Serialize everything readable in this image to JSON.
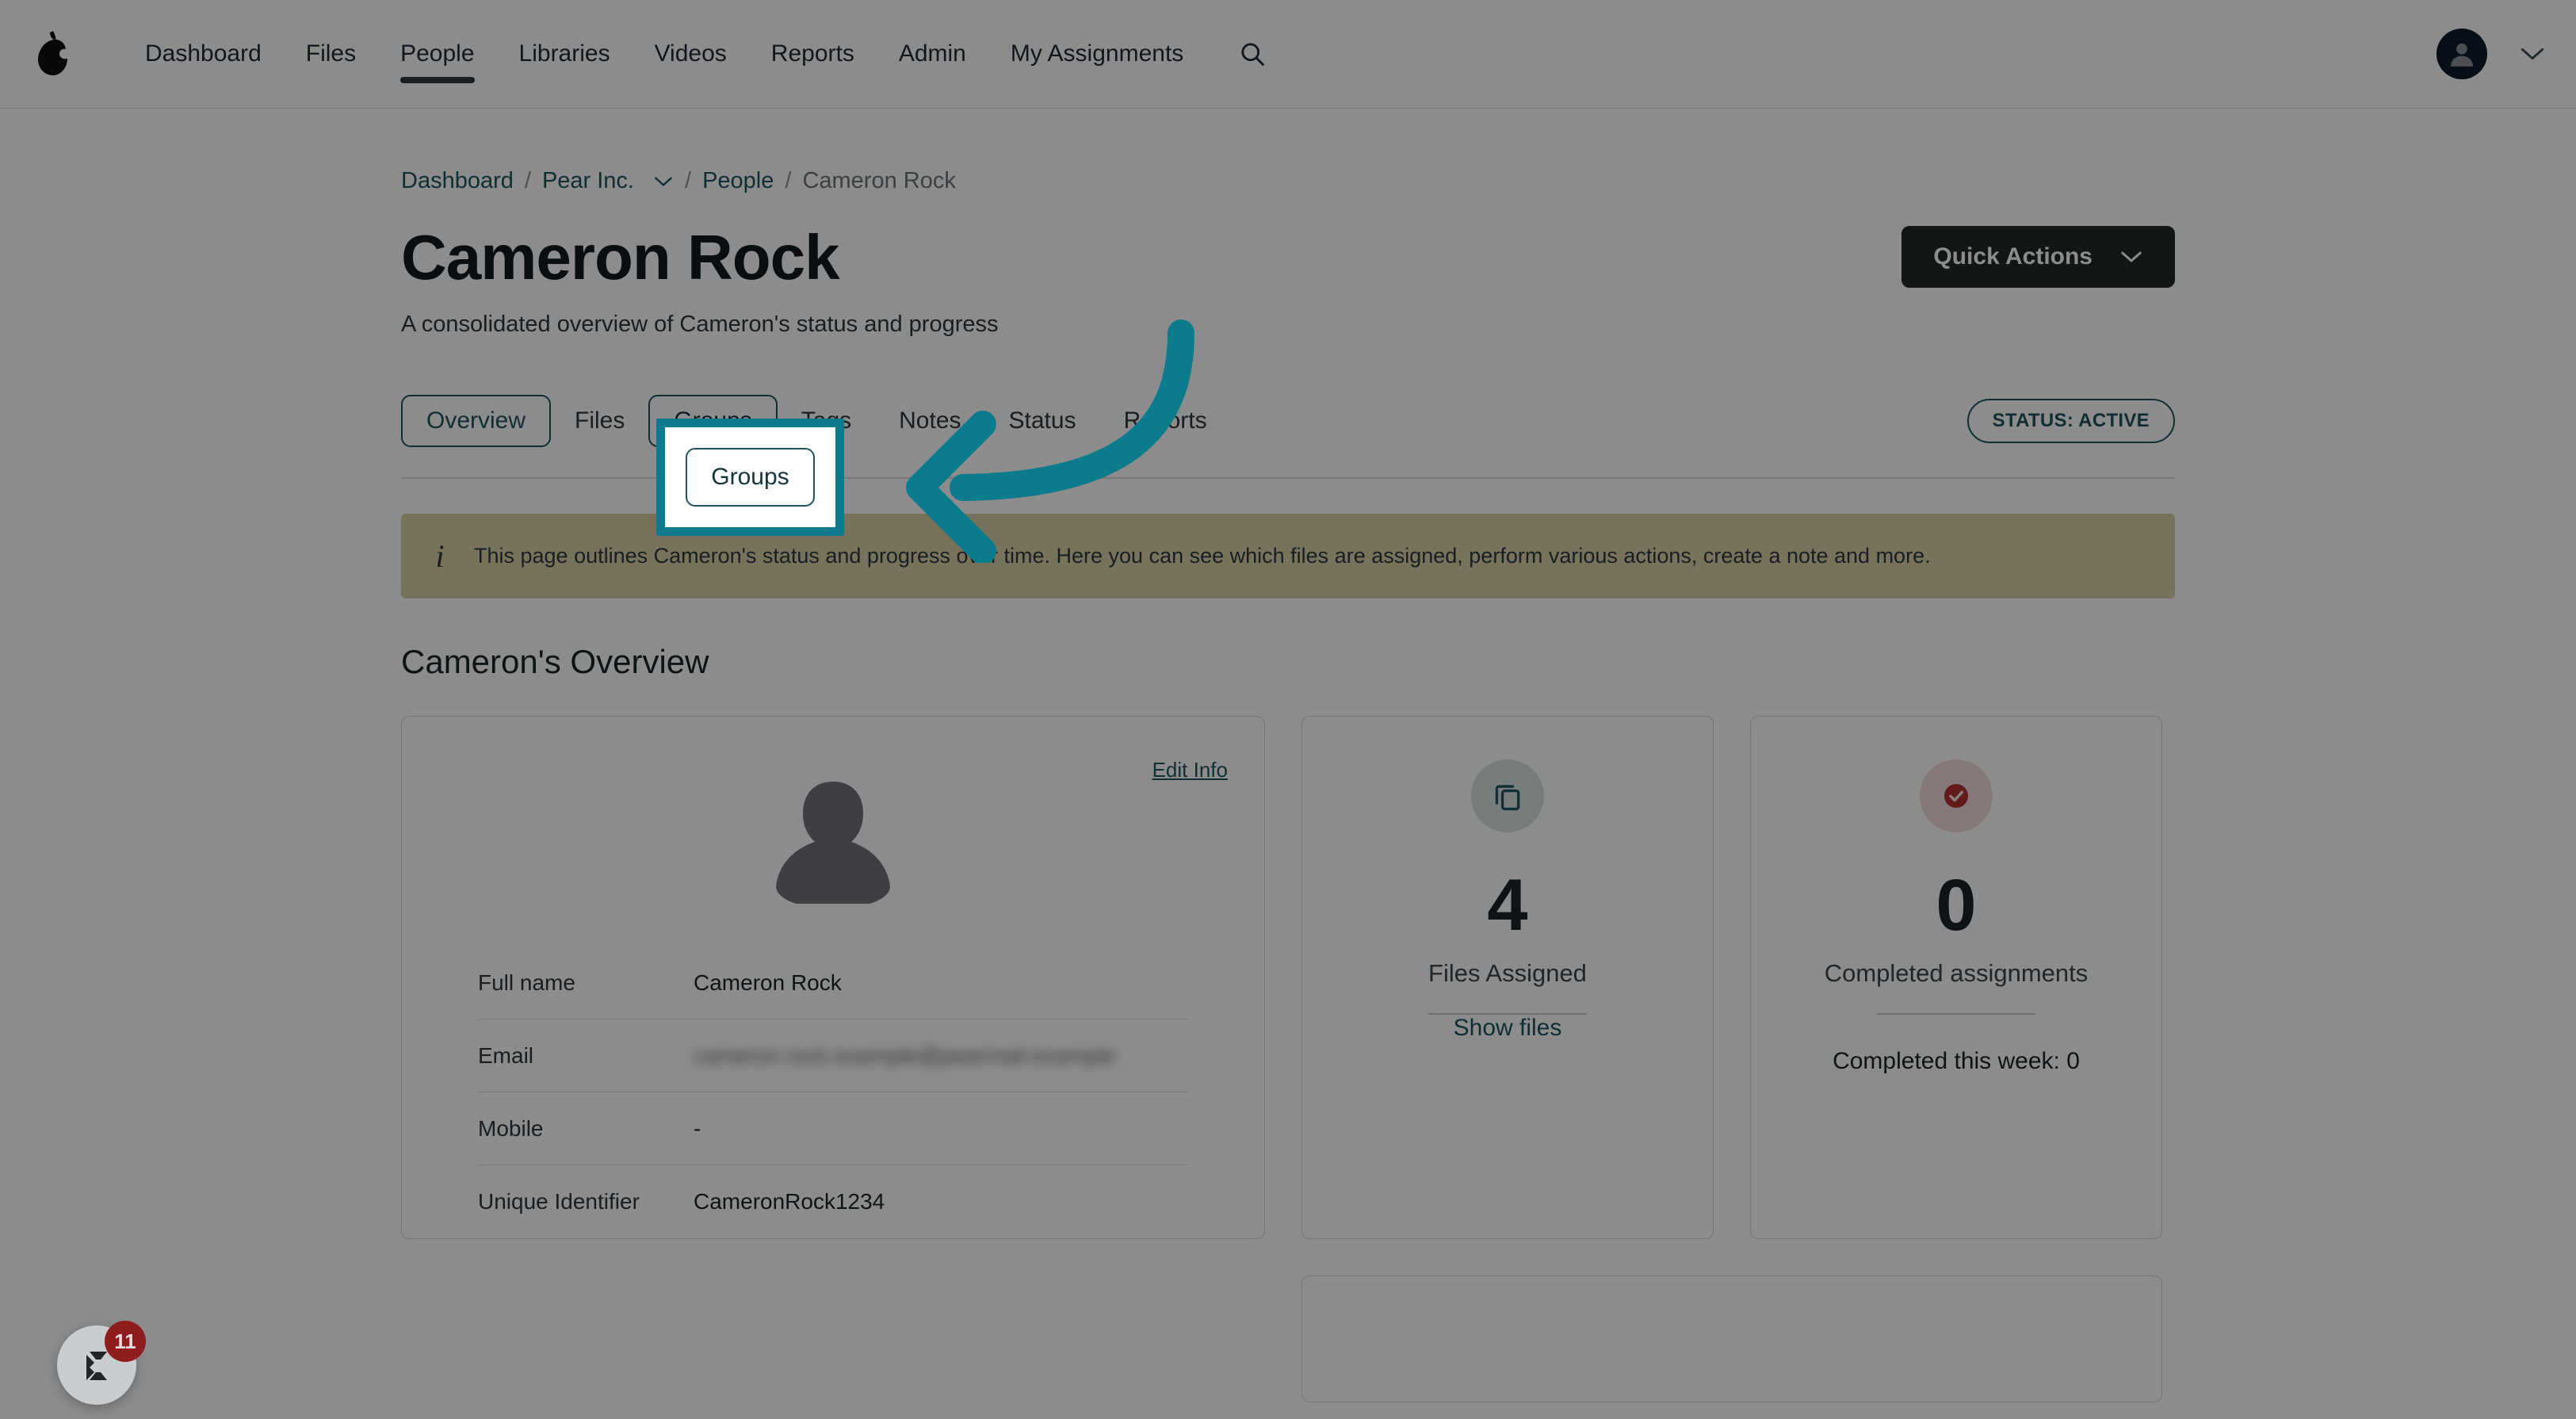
{
  "topnav": {
    "logo_icon": "pear-logo",
    "links": [
      {
        "label": "Dashboard",
        "active": false
      },
      {
        "label": "Files",
        "active": false
      },
      {
        "label": "People",
        "active": true
      },
      {
        "label": "Libraries",
        "active": false
      },
      {
        "label": "Videos",
        "active": false
      },
      {
        "label": "Reports",
        "active": false
      },
      {
        "label": "Admin",
        "active": false
      },
      {
        "label": "My Assignments",
        "active": false
      }
    ],
    "search_icon": "search-icon",
    "avatar_icon": "user-avatar-icon",
    "avatar_caret": "chevron-down-icon"
  },
  "breadcrumb": {
    "items": [
      {
        "label": "Dashboard",
        "type": "link"
      },
      {
        "label": "Pear Inc.",
        "type": "link",
        "caret": true
      },
      {
        "label": "People",
        "type": "link"
      },
      {
        "label": "Cameron Rock",
        "type": "current"
      }
    ],
    "separator": "/"
  },
  "header": {
    "title": "Cameron Rock",
    "subtitle": "A consolidated overview of Cameron's status and progress",
    "quick_actions_label": "Quick Actions",
    "quick_actions_caret": "chevron-down-icon"
  },
  "tabs": {
    "items": [
      {
        "label": "Overview",
        "state": "selected"
      },
      {
        "label": "Files",
        "state": "normal"
      },
      {
        "label": "Groups",
        "state": "highlighted"
      },
      {
        "label": "Tags",
        "state": "normal"
      },
      {
        "label": "Notes",
        "state": "normal"
      },
      {
        "label": "Status",
        "state": "normal"
      },
      {
        "label": "Reports",
        "state": "normal"
      }
    ],
    "status_badge": "STATUS: ACTIVE"
  },
  "info_banner": {
    "icon": "info-icon",
    "text": "This page outlines Cameron's status and progress over time. Here you can see which files are assigned, perform various actions, create a note and more.",
    "background": "#d8cfa8"
  },
  "overview": {
    "section_title": "Cameron's Overview",
    "profile_card": {
      "edit_link": "Edit Info",
      "avatar_icon": "person-placeholder-icon",
      "rows": [
        {
          "label": "Full name",
          "value": "Cameron Rock",
          "redacted": false
        },
        {
          "label": "Email",
          "value": "cameron.rock.example@pearmail.example",
          "redacted": true
        },
        {
          "label": "Mobile",
          "value": "-",
          "redacted": false
        },
        {
          "label": "Unique Identifier",
          "value": "CameronRock1234",
          "redacted": false
        }
      ]
    },
    "stat_cards": [
      {
        "icon": "copy-files-icon",
        "icon_tone": "teal",
        "number": "4",
        "label": "Files Assigned",
        "footer_link": "Show files",
        "footer_text": null
      },
      {
        "icon": "check-circle-icon",
        "icon_tone": "red",
        "number": "0",
        "label": "Completed assignments",
        "footer_link": null,
        "footer_text": "Completed this week:  0"
      }
    ]
  },
  "chat_widget": {
    "icon": "chat-support-icon",
    "badge_count": "11"
  },
  "highlight": {
    "target_label": "Groups",
    "box_color": "#0c7b8c",
    "arrow_color": "#0c7b8c",
    "arrow_icon": "curved-left-arrow-icon"
  },
  "colors": {
    "accent_teal": "#1f5560",
    "highlight_teal": "#0c7b8c",
    "banner_tan": "#d8cfa8",
    "dark_button": "#22282b",
    "red_status": "#b23030"
  }
}
